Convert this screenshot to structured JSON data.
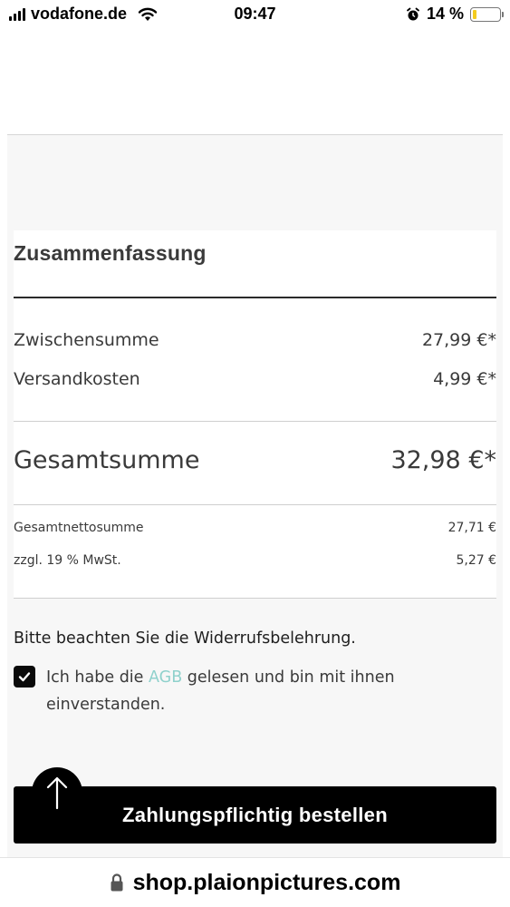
{
  "status_bar": {
    "carrier": "vodafone.de",
    "time": "09:47",
    "battery_percent": "14 %",
    "battery_level": 0.14,
    "battery_color": "#f4cc1f",
    "icons": [
      "signal-icon",
      "wifi-icon",
      "alarm-icon",
      "battery-icon"
    ]
  },
  "summary": {
    "title": "Zusammenfassung",
    "subtotal_label": "Zwischensumme",
    "subtotal_value": "27,99 €*",
    "shipping_label": "Versandkosten",
    "shipping_value": "4,99 €*",
    "total_label": "Gesamtsumme",
    "total_value": "32,98 €*",
    "net_label": "Gesamtnettosumme",
    "net_value": "27,71 €",
    "vat_label": "zzgl. 19 % MwSt.",
    "vat_value": "5,27 €"
  },
  "terms": {
    "notice": "Bitte beachten Sie die Widerrufsbelehrung.",
    "checkbox_checked": true,
    "text_before": "Ich habe die ",
    "link_text": "AGB",
    "text_after": " gelesen und bin mit ihnen einverstanden.",
    "link_color": "#8fd1cc"
  },
  "actions": {
    "order_button_label": "Zahlungspflichtig bestellen",
    "scroll_top_icon": "arrow-up-icon"
  },
  "browser": {
    "url": "shop.plaionpictures.com",
    "lock_icon": "lock-icon"
  }
}
